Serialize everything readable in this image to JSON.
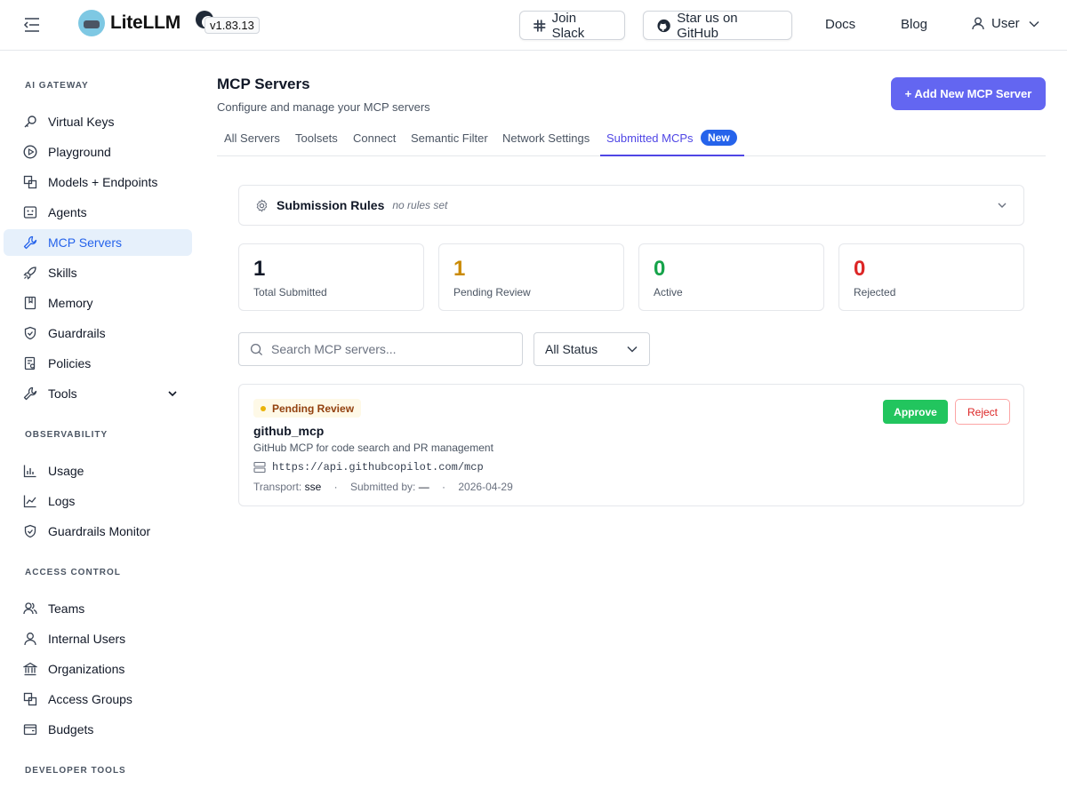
{
  "header": {
    "app_name": "LiteLLM",
    "version": "v1.83.13",
    "join_slack": "Join Slack",
    "star_github": "Star us on GitHub",
    "docs": "Docs",
    "blog": "Blog",
    "user": "User"
  },
  "sidebar": {
    "sections": [
      {
        "title": "AI GATEWAY",
        "items": [
          "Virtual Keys",
          "Playground",
          "Models + Endpoints",
          "Agents",
          "MCP Servers",
          "Skills",
          "Memory",
          "Guardrails",
          "Policies",
          "Tools"
        ]
      },
      {
        "title": "OBSERVABILITY",
        "items": [
          "Usage",
          "Logs",
          "Guardrails Monitor"
        ]
      },
      {
        "title": "ACCESS CONTROL",
        "items": [
          "Teams",
          "Internal Users",
          "Organizations",
          "Access Groups",
          "Budgets"
        ]
      },
      {
        "title": "DEVELOPER TOOLS",
        "items": []
      }
    ],
    "active_item": "MCP Servers"
  },
  "page": {
    "title": "MCP Servers",
    "subtitle": "Configure and manage your MCP servers",
    "add_button": "+ Add New MCP Server",
    "tabs": [
      "All Servers",
      "Toolsets",
      "Connect",
      "Semantic Filter",
      "Network Settings",
      "Submitted MCPs"
    ],
    "active_tab": "Submitted MCPs",
    "new_badge": "New"
  },
  "rules": {
    "title": "Submission Rules",
    "note": "no rules set"
  },
  "stats": [
    {
      "value": "1",
      "label": "Total Submitted",
      "color": "#111827"
    },
    {
      "value": "1",
      "label": "Pending Review",
      "color": "#ca8a04"
    },
    {
      "value": "0",
      "label": "Active",
      "color": "#16a34a"
    },
    {
      "value": "0",
      "label": "Rejected",
      "color": "#dc2626"
    }
  ],
  "filters": {
    "search_placeholder": "Search MCP servers...",
    "status_value": "All Status"
  },
  "submission": {
    "status": "Pending Review",
    "name": "github_mcp",
    "description": "GitHub MCP for code search and PR management",
    "url": "https://api.githubcopilot.com/mcp",
    "transport_label": "Transport:",
    "transport": "sse",
    "submitted_by_label": "Submitted by:",
    "submitted_by": "—",
    "date": "2026-04-29",
    "approve": "Approve",
    "reject": "Reject"
  },
  "colors": {
    "accent": "#6366f1",
    "active_nav_bg": "#e6f0fb",
    "approve": "#22c55e",
    "reject": "#dc2626"
  }
}
